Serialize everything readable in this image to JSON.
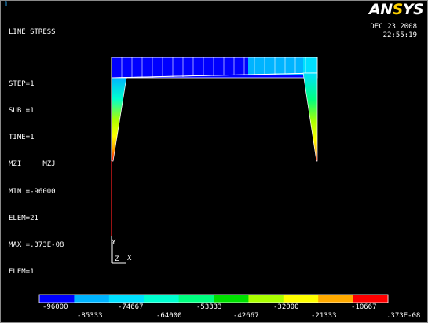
{
  "window_number": "1",
  "title": "LINE STRESS",
  "info_lines": [
    "STEP=1",
    "SUB =1",
    "TIME=1",
    "MZI     MZJ",
    "MIN =-96000",
    "ELEM=21",
    "MAX =.373E-08",
    "ELEM=1"
  ],
  "logo": {
    "an": "AN",
    "s": "S",
    "ys": "YS"
  },
  "date": "DEC 23 2008",
  "time": "22:55:19",
  "triad": {
    "y": "Y",
    "z": "Z",
    "x": "X"
  },
  "legend": {
    "colors": [
      "#0000ff",
      "#00b4ff",
      "#00e0ff",
      "#00ffd0",
      "#00ff80",
      "#00e000",
      "#aaff00",
      "#ffff00",
      "#ffaa00",
      "#ff0000"
    ],
    "top_labels": [
      "-96000",
      "-74667",
      "-53333",
      "-32000",
      "-10667"
    ],
    "bottom_labels": [
      "-85333",
      "-64000",
      "-42667",
      "-21333",
      ".373E-08"
    ]
  }
}
